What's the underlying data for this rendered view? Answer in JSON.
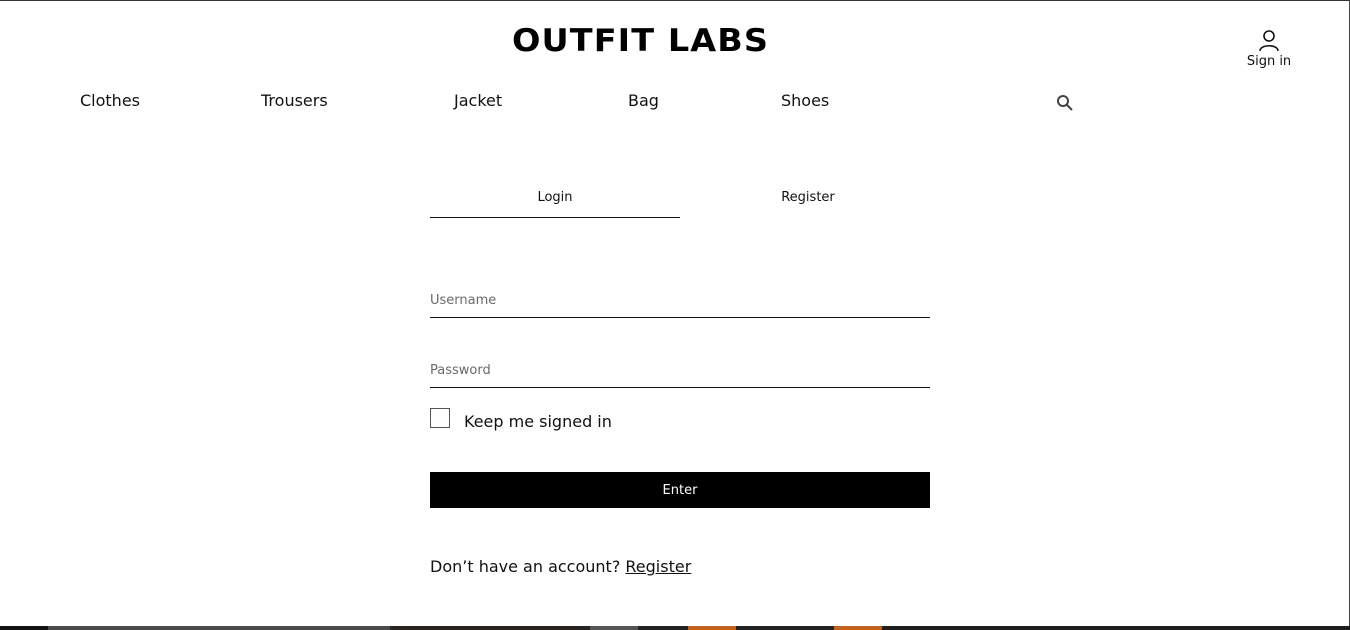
{
  "header": {
    "logo_text": "OUTFIT LABS",
    "account": {
      "icon": "user-icon",
      "label": "Sign in"
    },
    "search_icon": "search-icon"
  },
  "nav": {
    "items": [
      {
        "label": "Clothes"
      },
      {
        "label": "Trousers"
      },
      {
        "label": "Jacket"
      },
      {
        "label": "Bag"
      },
      {
        "label": "Shoes"
      }
    ]
  },
  "auth": {
    "tabs": [
      {
        "label": "Login",
        "active": true
      },
      {
        "label": "Register",
        "active": false
      }
    ],
    "username": {
      "placeholder": "Username",
      "value": ""
    },
    "password": {
      "placeholder": "Password",
      "value": ""
    },
    "remember": {
      "label": "Keep me signed in",
      "checked": false
    },
    "submit_label": "Enter",
    "signup_prompt": "Don’t have an account?",
    "signup_link": "Register"
  },
  "colors": {
    "primary": "#000000",
    "background": "#ffffff",
    "text": "#111111",
    "placeholder": "#6a6a6a",
    "accent_orange": "#c0631f"
  }
}
